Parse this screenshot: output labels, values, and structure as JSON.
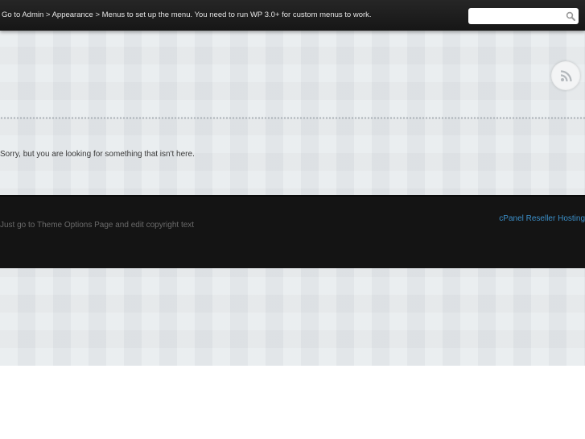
{
  "topbar": {
    "menu_message": "Go to Admin > Appearance > Menus to set up the menu. You need to run WP 3.0+ for custom menus to work.",
    "search": {
      "value": "",
      "placeholder": "",
      "icon": "search-icon"
    }
  },
  "header": {
    "rss_icon": "rss-icon"
  },
  "content": {
    "not_found_message": "Sorry, but you are looking for something that isn't here."
  },
  "footer": {
    "copyright_text": "Just go to Theme Options Page and edit copyright text",
    "link_label": "cPanel Reseller Hosting",
    "link_color": "#3b8fc9"
  },
  "colors": {
    "topbar_bg": "#1c1c1c",
    "footer_bg": "#141414",
    "page_bg": "#e3e7ea"
  }
}
